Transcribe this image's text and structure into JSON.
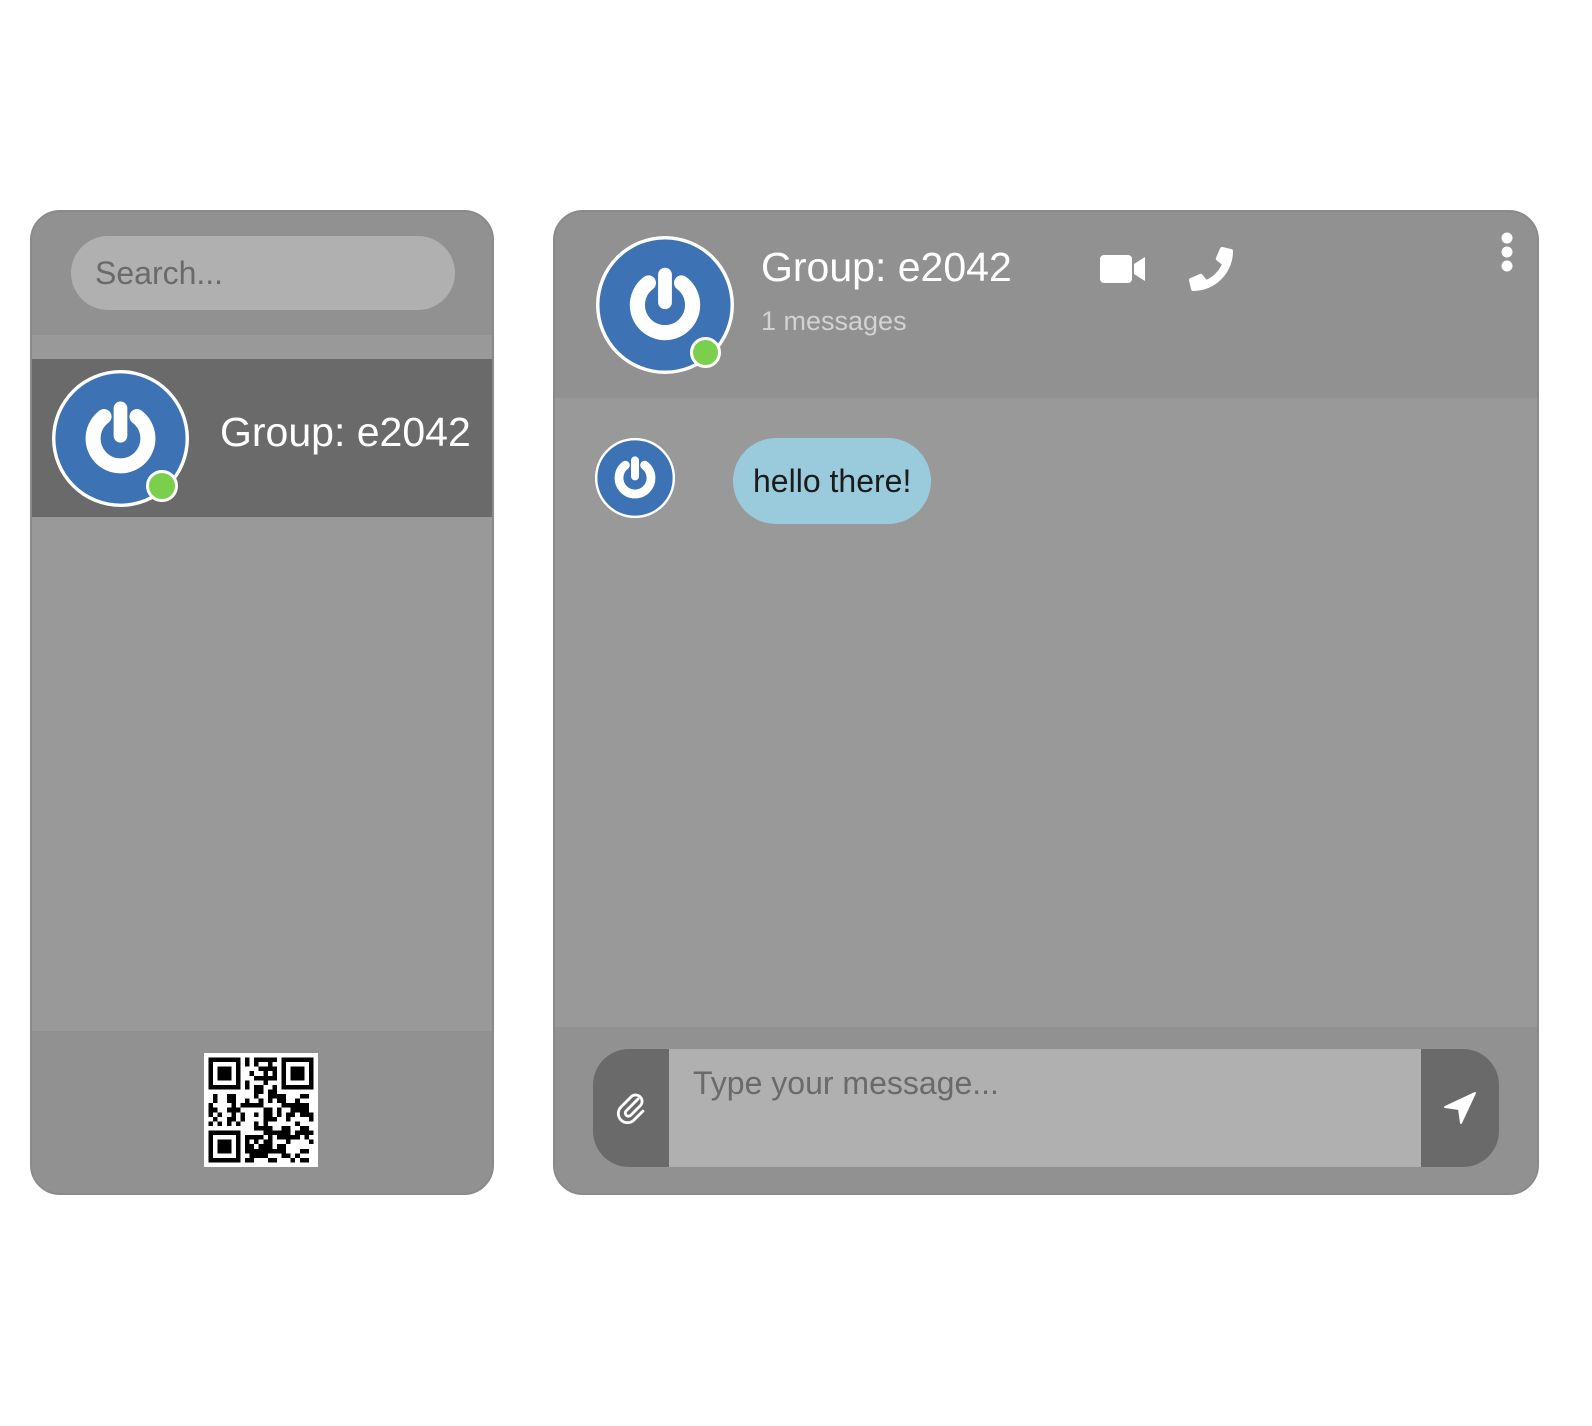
{
  "sidebar": {
    "search": {
      "placeholder": "Search..."
    },
    "contacts": [
      {
        "name": "Group: e2042",
        "online": true
      }
    ]
  },
  "chat": {
    "title": "Group: e2042",
    "subtitle": "1 messages",
    "messages": [
      {
        "text": "hello there!"
      }
    ],
    "composer": {
      "placeholder": "Type your message..."
    }
  },
  "colors": {
    "avatar_blue": "#3d72b4",
    "online_green": "#7ccf4d",
    "bubble": "#99cbdc",
    "panel_bg": "#999999",
    "dark_button": "#666666"
  },
  "icons": [
    "search-icon",
    "qr-code-icon",
    "video-camera-icon",
    "phone-icon",
    "more-vertical-icon",
    "paperclip-icon",
    "send-icon"
  ]
}
